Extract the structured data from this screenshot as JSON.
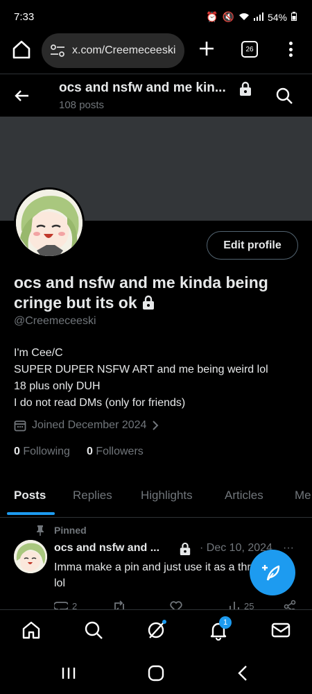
{
  "status_bar": {
    "time": "7:33",
    "battery": "54%"
  },
  "browser": {
    "url": "x.com/Creemeceeski",
    "tab_count": "26"
  },
  "header": {
    "title": "ocs and nsfw and me kin...",
    "posts_count": "108 posts"
  },
  "profile": {
    "edit_button": "Edit profile",
    "display_name": "ocs and nsfw and me kinda being cringe but its ok",
    "handle": "@Creemeceeski",
    "bio": [
      "I'm Cee/C",
      "SUPER DUPER NSFW ART and me being weird lol",
      "18 plus only DUH",
      "I do not read DMs (only for friends)"
    ],
    "joined": "Joined December 2024",
    "following_count": "0",
    "following_label": "Following",
    "followers_count": "0",
    "followers_label": "Followers"
  },
  "tabs": [
    {
      "label": "Posts",
      "active": true
    },
    {
      "label": "Replies",
      "active": false
    },
    {
      "label": "Highlights",
      "active": false
    },
    {
      "label": "Articles",
      "active": false
    },
    {
      "label": "Me",
      "active": false
    }
  ],
  "pinned_post": {
    "pinned_label": "Pinned",
    "author": "ocs and nsfw and ...",
    "date": "· Dec 10, 2024",
    "more": "···",
    "text": "Imma make a pin and just use it as a thread lol",
    "reply_count": "2",
    "view_count": "25"
  },
  "bottom_nav": {
    "notification_badge": "1"
  },
  "colors": {
    "accent": "#1d9bf0",
    "background": "#000000",
    "banner": "#333639",
    "muted_text": "#71767b"
  }
}
